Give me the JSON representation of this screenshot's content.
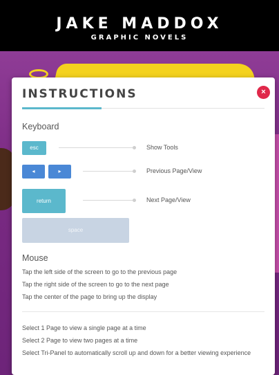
{
  "brand": {
    "line1": "JAKE MADDOX",
    "line2": "GRAPHIC NOVELS"
  },
  "modal": {
    "title": "INSTRUCTIONS",
    "close_symbol": "×",
    "keyboard": {
      "heading": "Keyboard",
      "keys": {
        "esc": "esc",
        "prev_symbol": "◂",
        "next_symbol": "▸",
        "return": "return",
        "space": "space"
      },
      "actions": {
        "show_tools": "Show Tools",
        "previous": "Previous Page/View",
        "next": "Next Page/View"
      }
    },
    "mouse": {
      "heading": "Mouse",
      "lines": [
        "Tap the left side of the screen to go to the previous page",
        "Tap the right side of the screen to go to the next page",
        "Tap the center of the page to bring up the display"
      ]
    },
    "view_modes": [
      "Select 1 Page to view a single page at a time",
      "Select 2 Page to view two pages at a time",
      "Select Tri-Panel to automatically scroll up and down for a better viewing experience"
    ]
  },
  "colors": {
    "accent": "#5bb8cc",
    "arrow_keys": "#4a88d6",
    "close": "#e0284a",
    "background": "#7a2a83"
  }
}
